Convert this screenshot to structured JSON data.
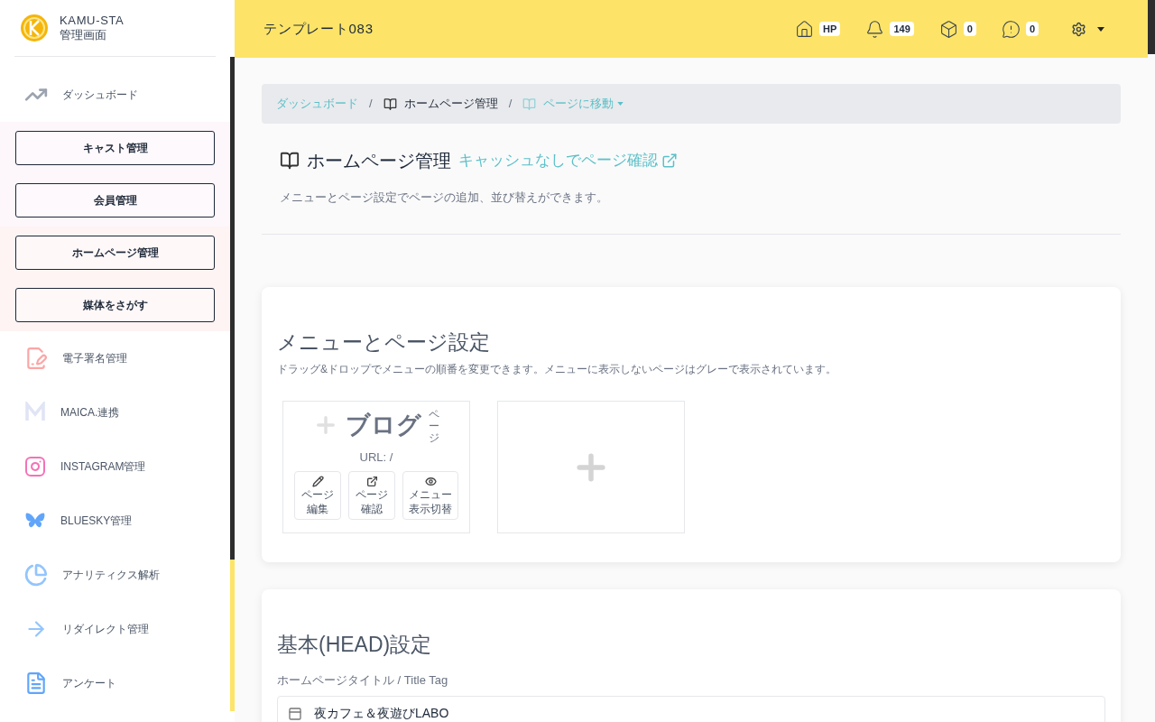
{
  "sidebar": {
    "brand": {
      "name": "KAMU-STA",
      "subtitle": "管理画面"
    },
    "items": [
      {
        "kind": "link",
        "label": "ダッシュボード"
      },
      {
        "kind": "button",
        "label": "キャスト管理",
        "color": "#fdf6fb"
      },
      {
        "kind": "button",
        "label": "会員管理",
        "color": "#fdf6fb"
      },
      {
        "kind": "button",
        "label": "ホームページ管理",
        "color": "#fdf4f3"
      },
      {
        "kind": "button",
        "label": "媒体をさがす",
        "color": "#fdf4f3"
      },
      {
        "kind": "link",
        "label": "電子署名管理"
      },
      {
        "kind": "link",
        "label": "MAICA.連携"
      },
      {
        "kind": "link",
        "label": "INSTAGRAM管理"
      },
      {
        "kind": "link",
        "label": "BLUESKY管理"
      },
      {
        "kind": "link",
        "label": "アナリティクス解析"
      },
      {
        "kind": "link",
        "label": "リダイレクト管理"
      },
      {
        "kind": "link",
        "label": "アンケート"
      }
    ]
  },
  "header": {
    "title": "テンプレート083",
    "badges": [
      "HP",
      "149",
      "0",
      "0"
    ]
  },
  "breadcrumb": [
    {
      "label": "ダッシュボード",
      "kind": "link"
    },
    {
      "separator": "/",
      "label": "ホームページ管理",
      "kind": "current"
    },
    {
      "separator": "/",
      "label": "ページに移動",
      "kind": "dropdown"
    }
  ],
  "page": {
    "title": "ホームページ管理",
    "link": "キャッシュなしでページ確認",
    "description": "メニューとページ設定でページの追加、並び替えができます。"
  },
  "menu_section": {
    "title": "メニューとページ設定",
    "hint": "ドラッグ&ドロップでメニューの順番を変更できます。メニューに表示しないページはグレーで表示されています。",
    "pages": [
      {
        "name": "ブログ",
        "tag": "ページ",
        "url": "URL: /",
        "actions": [
          {
            "lines": [
              "ページ",
              "編集"
            ]
          },
          {
            "lines": [
              "ページ",
              "確認"
            ]
          },
          {
            "lines": [
              "メニュー",
              "表示切替"
            ]
          }
        ]
      }
    ]
  },
  "head_section": {
    "title": "基本(HEAD)設定",
    "field_label": "ホームページタイトル / Title Tag",
    "field_value": "夜カフェ＆夜遊びLABO"
  }
}
